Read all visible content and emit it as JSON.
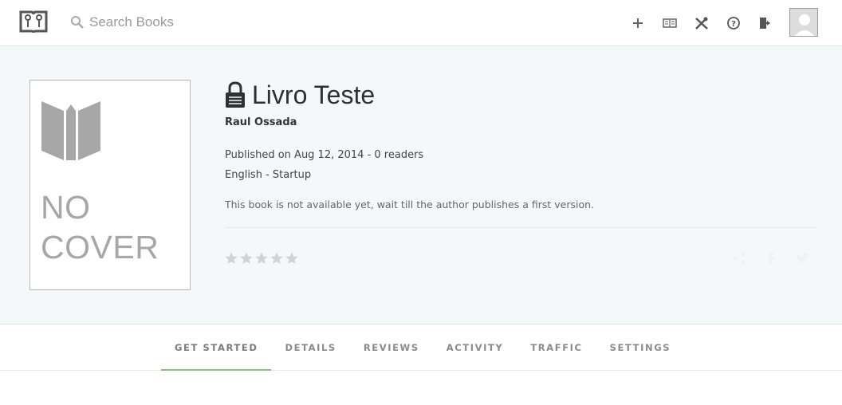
{
  "header": {
    "search_placeholder": "Search Books",
    "icons": [
      "logo-book-icon",
      "search-icon",
      "plus-icon",
      "library-icon",
      "tools-icon",
      "help-icon",
      "logout-icon",
      "avatar"
    ]
  },
  "book": {
    "title": "Livro Teste",
    "author": "Raul Ossada",
    "published": "Published on Aug 12, 2014 - 0 readers",
    "category": "English - Startup",
    "notice": "This book is not available yet, wait till the author publishes a first version.",
    "cover_line1": "NO",
    "cover_line2": "COVER",
    "rating": 0,
    "rating_max": 5
  },
  "tabs": [
    {
      "label": "GET STARTED",
      "active": true
    },
    {
      "label": "DETAILS",
      "active": false
    },
    {
      "label": "REVIEWS",
      "active": false
    },
    {
      "label": "ACTIVITY",
      "active": false
    },
    {
      "label": "TRAFFIC",
      "active": false
    },
    {
      "label": "SETTINGS",
      "active": false
    }
  ],
  "colors": {
    "accent": "#7cc576",
    "hero_bg": "#f4f8f8",
    "star_empty": "#cfd3d3"
  }
}
